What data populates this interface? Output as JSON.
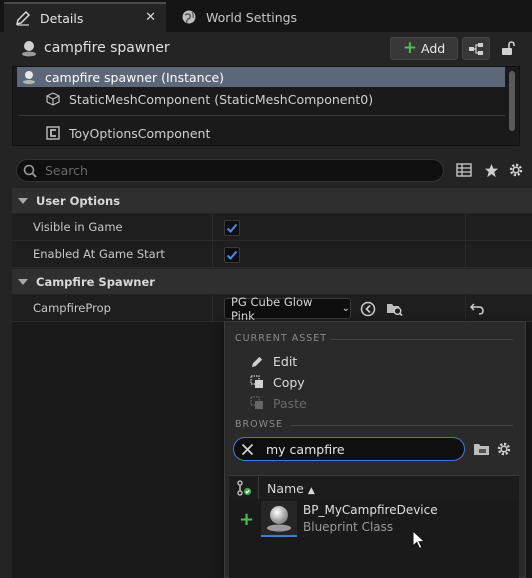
{
  "tabs": [
    {
      "label": "Details",
      "icon": "pencil-icon",
      "active": true
    },
    {
      "label": "World Settings",
      "icon": "globe-icon",
      "active": false
    }
  ],
  "header": {
    "title": "campfire spawner",
    "add_label": "Add"
  },
  "components": {
    "items": [
      {
        "label": "campfire spawner (Instance)",
        "selected": true
      },
      {
        "label": "StaticMeshComponent (StaticMeshComponent0)"
      },
      {
        "label": "ToyOptionsComponent"
      }
    ]
  },
  "search": {
    "placeholder": "Search"
  },
  "categories": {
    "user_options": {
      "title": "User Options",
      "props": [
        {
          "label": "Visible in Game",
          "checked": true
        },
        {
          "label": "Enabled At Game Start",
          "checked": true
        }
      ]
    },
    "campfire_spawner": {
      "title": "Campfire Spawner",
      "prop_label": "CampfireProp",
      "prop_value": "PG Cube Glow Pink"
    }
  },
  "popup": {
    "current_asset_title": "CURRENT ASSET",
    "edit_label": "Edit",
    "copy_label": "Copy",
    "paste_label": "Paste",
    "browse_title": "BROWSE",
    "search_value": "my campfire",
    "column_name": "Name",
    "asset": {
      "name": "BP_MyCampfireDevice",
      "type": "Blueprint Class"
    }
  },
  "colors": {
    "accent": "#3f7bd6",
    "selection": "#5c6878",
    "add_green": "#4cbf4c"
  }
}
